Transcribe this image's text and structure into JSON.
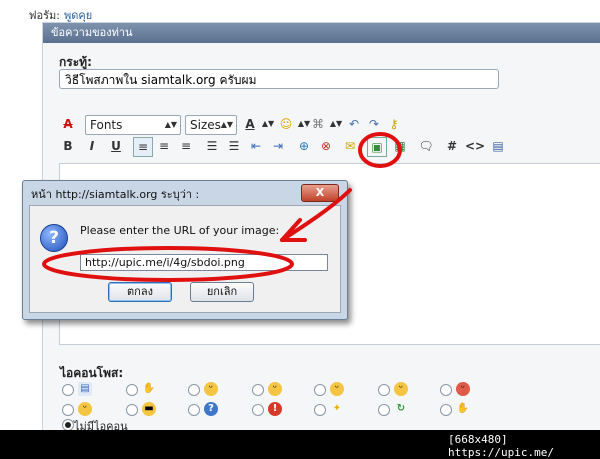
{
  "breadcrumb": {
    "label": "ฟอรัม:",
    "link": "พูดคุย"
  },
  "panel": {
    "title": "ข้อความของท่าน"
  },
  "subject": {
    "label": "กระทู้:",
    "value": "วิธีโพสภาพใน siamtalk.org ครับผม"
  },
  "toolbar": {
    "font_select": "Fonts",
    "size_select": "Sizes"
  },
  "dialog": {
    "title": "หน้า http://siamtalk.org ระบุว่า :",
    "close": "X",
    "prompt": "Please enter the URL of your image:",
    "url_value": "http://upic.me/i/4g/sbdoi.png",
    "ok_label": "ตกลง",
    "cancel_label": "ยกเลิก"
  },
  "post_icons": {
    "label": "ไอคอนโพส:",
    "no_icon_label": "ไม่มีไอคอน"
  },
  "footer": {
    "text": "[668x480] https://upic.me/"
  }
}
